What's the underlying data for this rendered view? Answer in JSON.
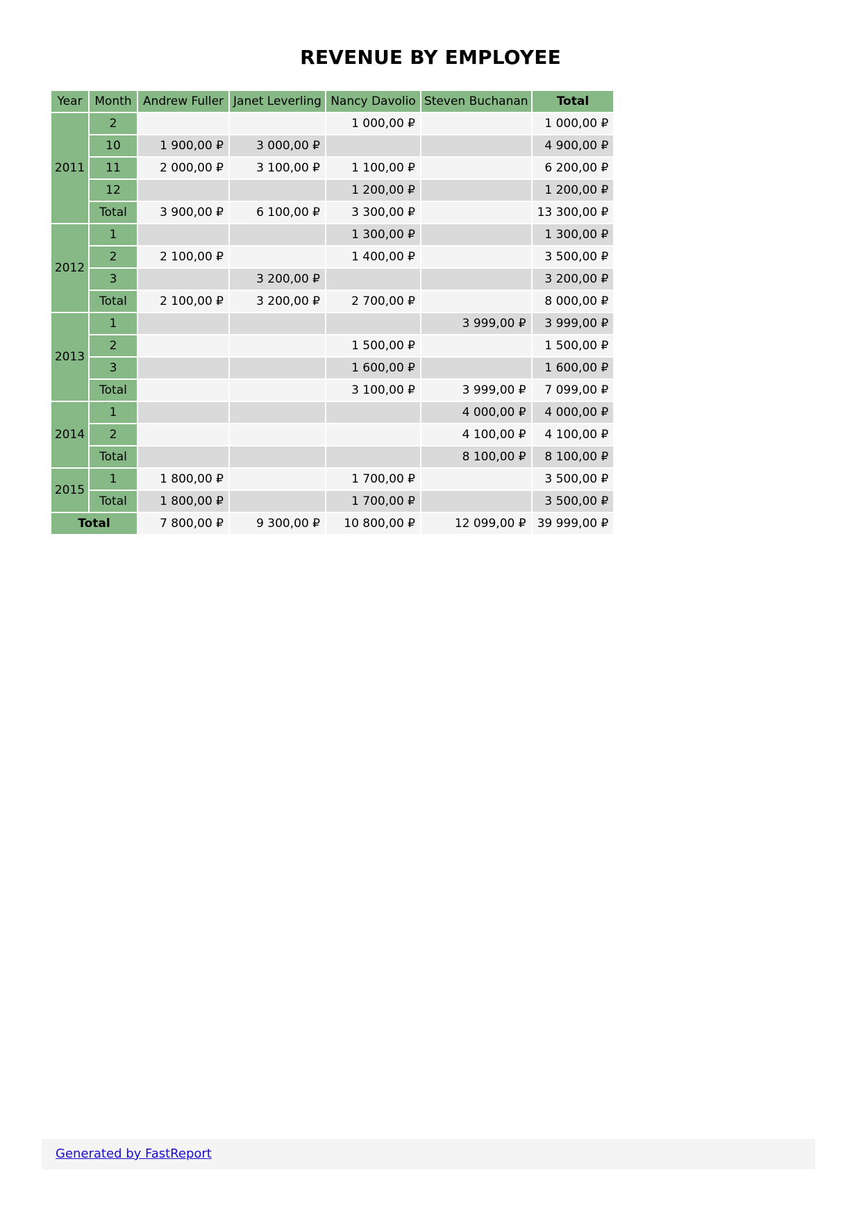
{
  "report": {
    "title": "REVENUE BY EMPLOYEE"
  },
  "table": {
    "headers": {
      "year": "Year",
      "month": "Month",
      "employees": [
        "Andrew Fuller",
        "Janet Leverling",
        "Nancy Davolio",
        "Steven Buchanan"
      ],
      "total": "Total"
    },
    "years": [
      {
        "year": "2011",
        "rows": [
          {
            "month": "2",
            "values": [
              "",
              "",
              "1 000,00 ₽",
              ""
            ],
            "total": "1 000,00 ₽"
          },
          {
            "month": "10",
            "values": [
              "1 900,00 ₽",
              "3 000,00 ₽",
              "",
              ""
            ],
            "total": "4 900,00 ₽"
          },
          {
            "month": "11",
            "values": [
              "2 000,00 ₽",
              "3 100,00 ₽",
              "1 100,00 ₽",
              ""
            ],
            "total": "6 200,00 ₽"
          },
          {
            "month": "12",
            "values": [
              "",
              "",
              "1 200,00 ₽",
              ""
            ],
            "total": "1 200,00 ₽"
          },
          {
            "month": "Total",
            "values": [
              "3 900,00 ₽",
              "6 100,00 ₽",
              "3 300,00 ₽",
              ""
            ],
            "total": "13 300,00 ₽"
          }
        ]
      },
      {
        "year": "2012",
        "rows": [
          {
            "month": "1",
            "values": [
              "",
              "",
              "1 300,00 ₽",
              ""
            ],
            "total": "1 300,00 ₽"
          },
          {
            "month": "2",
            "values": [
              "2 100,00 ₽",
              "",
              "1 400,00 ₽",
              ""
            ],
            "total": "3 500,00 ₽"
          },
          {
            "month": "3",
            "values": [
              "",
              "3 200,00 ₽",
              "",
              ""
            ],
            "total": "3 200,00 ₽"
          },
          {
            "month": "Total",
            "values": [
              "2 100,00 ₽",
              "3 200,00 ₽",
              "2 700,00 ₽",
              ""
            ],
            "total": "8 000,00 ₽"
          }
        ]
      },
      {
        "year": "2013",
        "rows": [
          {
            "month": "1",
            "values": [
              "",
              "",
              "",
              "3 999,00 ₽"
            ],
            "total": "3 999,00 ₽"
          },
          {
            "month": "2",
            "values": [
              "",
              "",
              "1 500,00 ₽",
              ""
            ],
            "total": "1 500,00 ₽"
          },
          {
            "month": "3",
            "values": [
              "",
              "",
              "1 600,00 ₽",
              ""
            ],
            "total": "1 600,00 ₽"
          },
          {
            "month": "Total",
            "values": [
              "",
              "",
              "3 100,00 ₽",
              "3 999,00 ₽"
            ],
            "total": "7 099,00 ₽"
          }
        ]
      },
      {
        "year": "2014",
        "rows": [
          {
            "month": "1",
            "values": [
              "",
              "",
              "",
              "4 000,00 ₽"
            ],
            "total": "4 000,00 ₽"
          },
          {
            "month": "2",
            "values": [
              "",
              "",
              "",
              "4 100,00 ₽"
            ],
            "total": "4 100,00 ₽"
          },
          {
            "month": "Total",
            "values": [
              "",
              "",
              "",
              "8 100,00 ₽"
            ],
            "total": "8 100,00 ₽"
          }
        ]
      },
      {
        "year": "2015",
        "rows": [
          {
            "month": "1",
            "values": [
              "1 800,00 ₽",
              "",
              "1 700,00 ₽",
              ""
            ],
            "total": "3 500,00 ₽"
          },
          {
            "month": "Total",
            "values": [
              "1 800,00 ₽",
              "",
              "1 700,00 ₽",
              ""
            ],
            "total": "3 500,00 ₽"
          }
        ]
      }
    ],
    "grand_total": {
      "label": "Total",
      "values": [
        "7 800,00 ₽",
        "9 300,00 ₽",
        "10 800,00 ₽",
        "12 099,00 ₽"
      ],
      "total": "39 999,00 ₽"
    }
  },
  "footer": {
    "link_text": "Generated by FastReport"
  }
}
